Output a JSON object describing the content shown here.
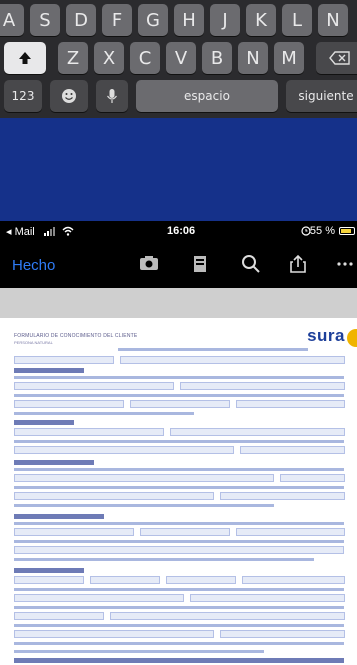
{
  "keyboard": {
    "row1": [
      "A",
      "S",
      "D",
      "F",
      "G",
      "H",
      "J",
      "K",
      "L",
      "N"
    ],
    "row2": [
      "Z",
      "X",
      "C",
      "V",
      "B",
      "N",
      "M"
    ],
    "row3": {
      "numbers_label": "123",
      "space_label": "espacio",
      "return_label": "siguiente"
    },
    "shift_icon": "shift-up-arrow-icon",
    "delete_icon": "backspace-icon",
    "emoji_icon": "emoji-icon",
    "mic_icon": "microphone-icon"
  },
  "banner": {
    "color": "#15318a"
  },
  "status_bar": {
    "back_app": "◂ Mail",
    "time": "16:06",
    "battery": "55 %"
  },
  "toolbar": {
    "done_label": "Hecho",
    "icons": [
      "camera-icon",
      "document-icon",
      "search-icon",
      "share-icon",
      "more-icon"
    ]
  },
  "document": {
    "title": "FORMULARIO DE CONOCIMIENTO DEL CLIENTE",
    "subtitle": "PERSONA NATURAL",
    "brand": "sura",
    "brand_color": "#1d3f9a",
    "accent_color": "#f0b400"
  }
}
